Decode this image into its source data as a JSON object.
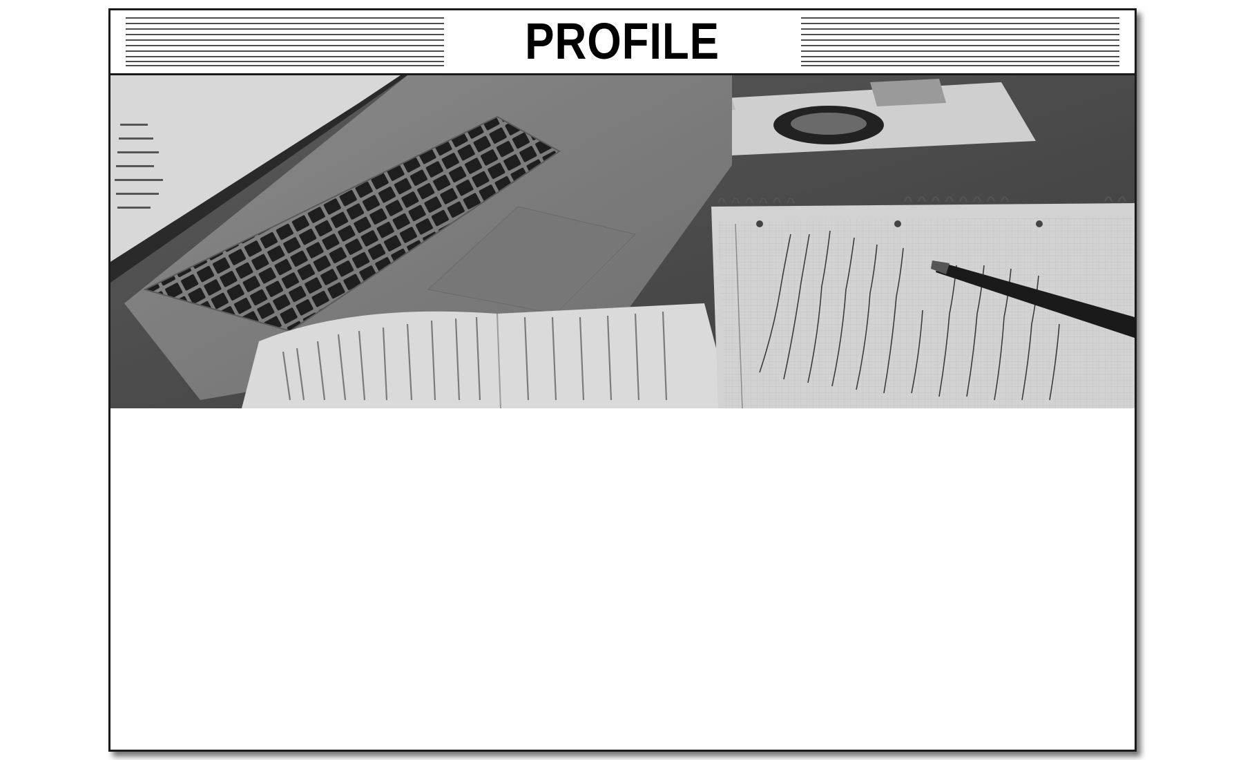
{
  "header": {
    "title": "PROFILE"
  },
  "hero_image": {
    "subject": "laptop-desk-notebook-photo"
  },
  "colors": {
    "ink": "#000000",
    "border": "#1a1a1a",
    "paper": "#ffffff"
  }
}
